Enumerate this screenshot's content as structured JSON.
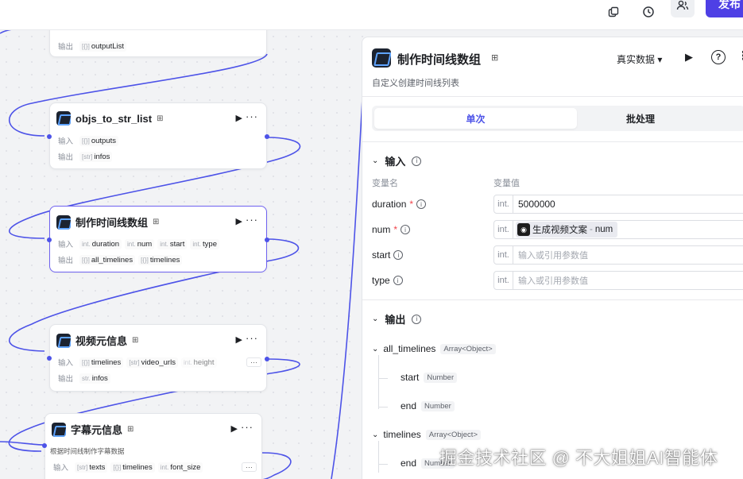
{
  "topbar": {
    "icons": [
      "copy-icon",
      "history-icon",
      "collaborators-icon"
    ],
    "publish_label": "发布"
  },
  "canvas": {
    "nodes": [
      {
        "title": "",
        "out_label": "输出",
        "out_chips": [
          {
            "type": "[{}]",
            "name": "outputList"
          }
        ]
      },
      {
        "title": "objs_to_str_list",
        "in_label": "输入",
        "in_chips": [
          {
            "type": "[{}]",
            "name": "outputs"
          }
        ],
        "out_label": "输出",
        "out_chips": [
          {
            "type": "[str]",
            "name": "infos"
          }
        ]
      },
      {
        "title": "制作时间线数组",
        "in_label": "输入",
        "in_chips": [
          {
            "type": "int.",
            "name": "duration"
          },
          {
            "type": "int.",
            "name": "num"
          },
          {
            "type": "int.",
            "name": "start"
          },
          {
            "type": "int.",
            "name": "type"
          }
        ],
        "out_label": "输出",
        "out_chips": [
          {
            "type": "[{}]",
            "name": "all_timelines"
          },
          {
            "type": "[{}]",
            "name": "timelines"
          }
        ]
      },
      {
        "title": "视频元信息",
        "in_label": "输入",
        "in_chips": [
          {
            "type": "[{}]",
            "name": "timelines"
          },
          {
            "type": "[str]",
            "name": "video_urls"
          },
          {
            "type": "int.",
            "name": "height"
          }
        ],
        "more": "···",
        "out_label": "输出",
        "out_chips": [
          {
            "type": "str.",
            "name": "infos"
          }
        ]
      },
      {
        "title": "字幕元信息",
        "desc": "根据时间线制作字幕数据",
        "in_label": "输入",
        "in_chips": [
          {
            "type": "[str]",
            "name": "texts"
          },
          {
            "type": "[{}]",
            "name": "timelines"
          },
          {
            "type": "int.",
            "name": "font_size"
          }
        ],
        "more": "···"
      }
    ]
  },
  "panel": {
    "title": "制作时间线数组",
    "description": "自定义创建时间线列表",
    "data_mode": "真实数据",
    "tabs": [
      "单次",
      "批处理"
    ],
    "input": {
      "header": "输入",
      "col_name": "变量名",
      "col_value": "变量值",
      "fields": [
        {
          "name": "duration",
          "required": "*",
          "type": "int.",
          "value": "5000000",
          "placeholder": ""
        },
        {
          "name": "num",
          "required": "*",
          "type": "int.",
          "ref_source": "生成视频文案",
          "ref_sep": "-",
          "ref_var": "num"
        },
        {
          "name": "start",
          "required": "",
          "type": "int.",
          "value": "",
          "placeholder": "输入或引用参数值"
        },
        {
          "name": "type",
          "required": "",
          "type": "int.",
          "value": "",
          "placeholder": "输入或引用参数值"
        }
      ]
    },
    "output": {
      "header": "输出",
      "groups": [
        {
          "name": "all_timelines",
          "type": "Array<Object>",
          "children": [
            {
              "name": "start",
              "type": "Number"
            },
            {
              "name": "end",
              "type": "Number"
            }
          ]
        },
        {
          "name": "timelines",
          "type": "Array<Object>",
          "children": [
            {
              "name": "end",
              "type": "Number"
            }
          ]
        }
      ]
    }
  },
  "watermark": "掘金技术社区 @ 不大姐姐AI智能体",
  "colors": {
    "accent": "#4d53e8",
    "publish": "#4e40e5",
    "required": "#f0434a"
  }
}
